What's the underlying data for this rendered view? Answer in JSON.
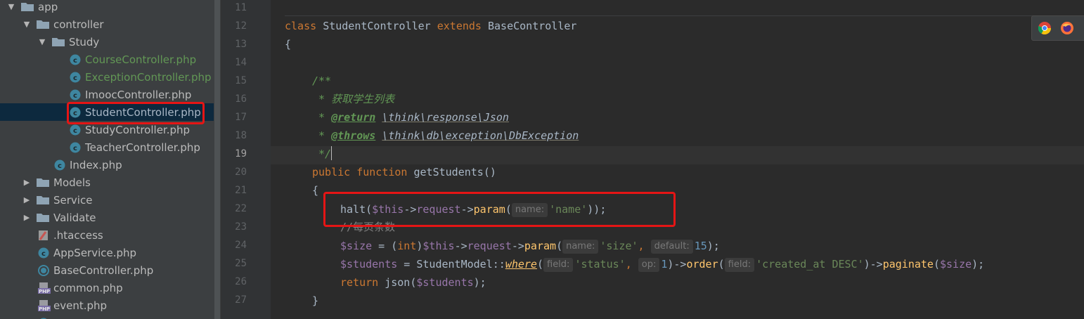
{
  "project_tree": {
    "items": [
      {
        "label": "app",
        "kind": "folder",
        "expanded": true
      },
      {
        "label": "controller",
        "kind": "folder",
        "expanded": true
      },
      {
        "label": "Study",
        "kind": "folder",
        "expanded": true
      },
      {
        "label": "CourseController.php",
        "kind": "class-file",
        "vcs": "added"
      },
      {
        "label": "ExceptionController.php",
        "kind": "class-file",
        "vcs": "added"
      },
      {
        "label": "ImoocController.php",
        "kind": "class-file",
        "vcs": "none"
      },
      {
        "label": "StudentController.php",
        "kind": "class-file",
        "vcs": "modified",
        "selected": true
      },
      {
        "label": "StudyController.php",
        "kind": "class-file",
        "vcs": "none"
      },
      {
        "label": "TeacherController.php",
        "kind": "class-file",
        "vcs": "none"
      },
      {
        "label": "Index.php",
        "kind": "class-file",
        "vcs": "none"
      },
      {
        "label": "Models",
        "kind": "folder",
        "expanded": false
      },
      {
        "label": "Service",
        "kind": "folder",
        "expanded": false
      },
      {
        "label": "Validate",
        "kind": "folder",
        "expanded": false
      },
      {
        "label": ".htaccess",
        "kind": "htaccess-file"
      },
      {
        "label": "AppService.php",
        "kind": "class-file",
        "vcs": "none"
      },
      {
        "label": "BaseController.php",
        "kind": "abstract-class-file",
        "vcs": "none"
      },
      {
        "label": "common.php",
        "kind": "php-file"
      },
      {
        "label": "event.php",
        "kind": "php-file"
      }
    ]
  },
  "editor": {
    "line_numbers": [
      "11",
      "12",
      "13",
      "14",
      "15",
      "16",
      "17",
      "18",
      "19",
      "20",
      "21",
      "22",
      "23",
      "24",
      "25",
      "26",
      "27"
    ],
    "current_line": "19",
    "code": {
      "l12": {
        "kw1": "class",
        "name": "StudentController",
        "kw2": "extends",
        "parent": "BaseController"
      },
      "l13": {
        "brace": "{"
      },
      "l15": {
        "doc_open": "/**"
      },
      "l16": {
        "doc_text": " * 获取学生列表"
      },
      "l17": {
        "star": " * ",
        "tag": "@return",
        "ref": "\\think\\response\\Json"
      },
      "l18": {
        "star": " * ",
        "tag": "@throws",
        "ref": "\\think\\db\\exception\\DbException"
      },
      "l19": {
        "doc_close": " */"
      },
      "l20": {
        "kw1": "public",
        "kw2": "function",
        "name": "getStudents",
        "parens": "()"
      },
      "l21": {
        "brace": "{"
      },
      "l22": {
        "fn": "halt",
        "p1": "(",
        "var": "$this",
        "arrow1": "->",
        "prop": "request",
        "arrow2": "->",
        "method": "param",
        "p2": "(",
        "hint": "name:",
        "str": "'name'",
        "close": "));"
      },
      "l23": {
        "comment": "//每页条数"
      },
      "l24": {
        "var": "$size",
        "eq": " = (",
        "cast": "int",
        "p": ")",
        "this": "$this",
        "arrow1": "->",
        "prop": "request",
        "arrow2": "->",
        "method": "param",
        "p2": "(",
        "hint1": "name:",
        "str": "'size'",
        "comma": ", ",
        "hint2": "default:",
        "num": "15",
        "close": ");"
      },
      "l25": {
        "var": "$students",
        "eq": " = StudentModel::",
        "method": "where",
        "p1": "(",
        "hint1": "field:",
        "str1": "'status'",
        "comma": ", ",
        "hint2": "op:",
        "num": "1",
        "mid": ")->",
        "m2": "order",
        "p2": "(",
        "hint3": "field:",
        "str2": "'created_at DESC'",
        "mid2": ")->",
        "m3": "paginate",
        "p3": "(",
        "var2": "$size",
        "close": ");"
      },
      "l26": {
        "kw": "return",
        "fn": " json(",
        "var": "$students",
        "close": ");"
      },
      "l27": {
        "brace": "}"
      }
    }
  },
  "browser_icons": [
    "chrome-icon",
    "firefox-icon"
  ],
  "colors": {
    "highlight_box": "#e51515",
    "keyword": "#cc7832",
    "string": "#6a8759",
    "variable": "#9876aa"
  }
}
